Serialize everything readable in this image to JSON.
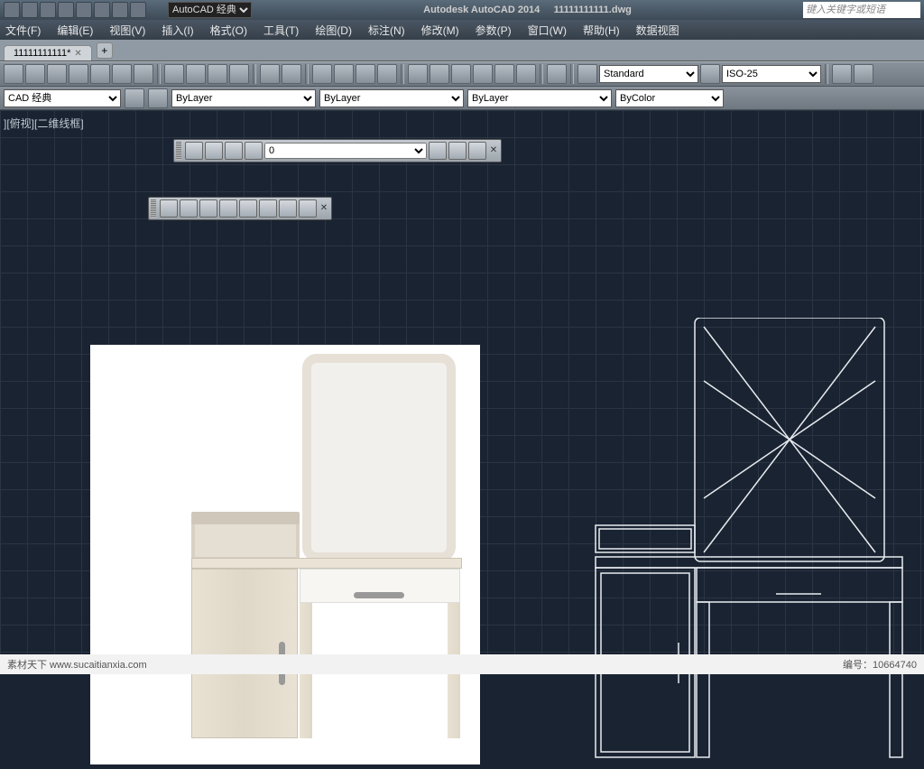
{
  "title": {
    "app": "Autodesk AutoCAD 2014",
    "file": "11111111111.dwg"
  },
  "search_placeholder": "键入关键字或短语",
  "workspace": "AutoCAD 经典",
  "menu": [
    "文件(F)",
    "编辑(E)",
    "视图(V)",
    "插入(I)",
    "格式(O)",
    "工具(T)",
    "绘图(D)",
    "标注(N)",
    "修改(M)",
    "参数(P)",
    "窗口(W)",
    "帮助(H)",
    "数据视图"
  ],
  "tab": {
    "name": "11111111111*"
  },
  "styles": {
    "text": "Standard",
    "dim": "ISO-25"
  },
  "props": {
    "workspace": "CAD 经典",
    "color": "ByLayer",
    "ltype": "ByLayer",
    "lweight": "ByLayer",
    "plot": "ByColor"
  },
  "view_label": "][俯视][二维线框]",
  "layer_combo": "0",
  "footer": {
    "site": "素材天下 www.sucaitianxia.com",
    "id_label": "编号：",
    "id": "10664740"
  }
}
